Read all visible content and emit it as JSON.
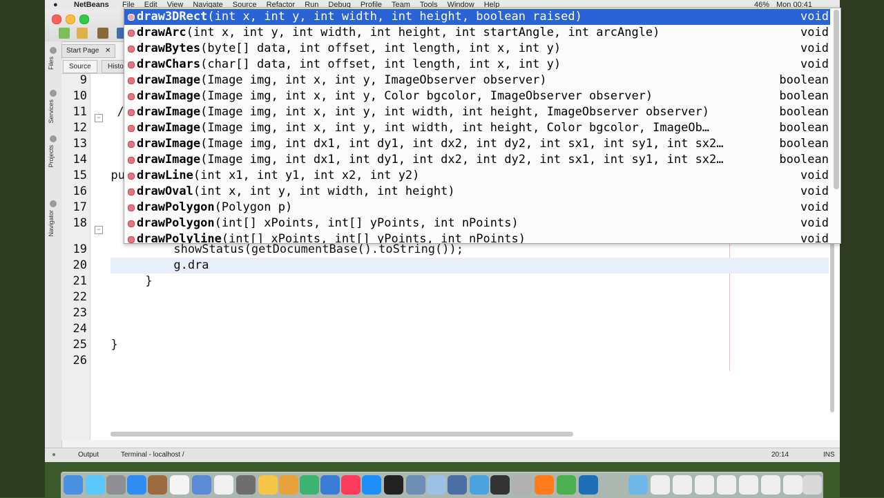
{
  "menubar": {
    "apple": "●",
    "app_name": "NetBeans",
    "menus": [
      "File",
      "Edit",
      "View",
      "Navigate",
      "Source",
      "Refactor",
      "Run",
      "Debug",
      "Profile",
      "Team",
      "Tools",
      "Window",
      "Help"
    ],
    "battery": "46%",
    "clock": "Mon 00:41"
  },
  "tabs": {
    "start_page": "Start Page",
    "close": "✕"
  },
  "subtabs": {
    "source": "Source",
    "history": "Histo"
  },
  "side_panels": [
    "Files",
    "Services",
    "Projects",
    "Navigator"
  ],
  "editor": {
    "lines": [
      {
        "n": "9",
        "text": ""
      },
      {
        "n": "10",
        "text": ""
      },
      {
        "n": "11",
        "text": "  /*"
      },
      {
        "n": "12",
        "text": "   *"
      },
      {
        "n": "13",
        "text": "   *"
      },
      {
        "n": "14",
        "text": "   *"
      },
      {
        "n": "15",
        "text": "  pu"
      },
      {
        "n": "16",
        "text": ""
      },
      {
        "n": "17",
        "text": ""
      },
      {
        "n": "18",
        "text": ""
      },
      {
        "n": "19",
        "text": "          showStatus(getDocumentBase().toString());"
      },
      {
        "n": "20",
        "text": "          g.dra"
      },
      {
        "n": "21",
        "text": "      }"
      },
      {
        "n": "22",
        "text": ""
      },
      {
        "n": "23",
        "text": ""
      },
      {
        "n": "24",
        "text": ""
      },
      {
        "n": "25",
        "text": "  }"
      },
      {
        "n": "26",
        "text": ""
      }
    ]
  },
  "autocomplete": {
    "items": [
      {
        "name": "draw3DRect",
        "sig": "(int x, int y, int width, int height, boolean raised)",
        "ret": "void"
      },
      {
        "name": "drawArc",
        "sig": "(int x, int y, int width, int height, int startAngle, int arcAngle)",
        "ret": "void"
      },
      {
        "name": "drawBytes",
        "sig": "(byte[] data, int offset, int length, int x, int y)",
        "ret": "void"
      },
      {
        "name": "drawChars",
        "sig": "(char[] data, int offset, int length, int x, int y)",
        "ret": "void"
      },
      {
        "name": "drawImage",
        "sig": "(Image img, int x, int y, ImageObserver observer)",
        "ret": "boolean"
      },
      {
        "name": "drawImage",
        "sig": "(Image img, int x, int y, Color bgcolor, ImageObserver observer)",
        "ret": "boolean"
      },
      {
        "name": "drawImage",
        "sig": "(Image img, int x, int y, int width, int height, ImageObserver observer)",
        "ret": "boolean"
      },
      {
        "name": "drawImage",
        "sig": "(Image img, int x, int y, int width, int height, Color bgcolor, ImageOb…",
        "ret": "boolean"
      },
      {
        "name": "drawImage",
        "sig": "(Image img, int dx1, int dy1, int dx2, int dy2, int sx1, int sy1, int sx2…",
        "ret": "boolean"
      },
      {
        "name": "drawImage",
        "sig": "(Image img, int dx1, int dy1, int dx2, int dy2, int sx1, int sy1, int sx2…",
        "ret": "boolean"
      },
      {
        "name": "drawLine",
        "sig": "(int x1, int y1, int x2, int y2)",
        "ret": "void"
      },
      {
        "name": "drawOval",
        "sig": "(int x, int y, int width, int height)",
        "ret": "void"
      },
      {
        "name": "drawPolygon",
        "sig": "(Polygon p)",
        "ret": "void"
      },
      {
        "name": "drawPolygon",
        "sig": "(int[] xPoints, int[] yPoints, int nPoints)",
        "ret": "void"
      },
      {
        "name": "drawPolyline",
        "sig": "(int[] xPoints, int[] yPoints, int nPoints)",
        "ret": "void"
      }
    ]
  },
  "statusbar": {
    "output": "Output",
    "terminal": "Terminal - localhost /",
    "position": "20:14",
    "mode": "INS"
  },
  "colors": {
    "selection": "#2a63d6",
    "method_bullet": "#e8737d",
    "current_line": "#e9effa"
  }
}
